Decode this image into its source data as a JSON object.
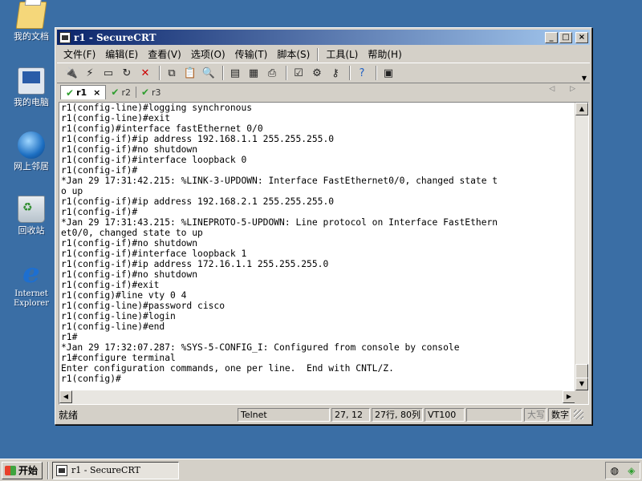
{
  "desktop": {
    "icons": [
      {
        "label": "我的文档"
      },
      {
        "label": "我的电脑"
      },
      {
        "label": "网上邻居"
      },
      {
        "label": "回收站"
      },
      {
        "label": "Internet Explorer"
      }
    ]
  },
  "window": {
    "title": "r1 - SecureCRT",
    "controls": {
      "minimize": "_",
      "maximize": "□",
      "close": "×"
    }
  },
  "menu": {
    "items": [
      "文件(F)",
      "编辑(E)",
      "查看(V)",
      "选项(O)",
      "传输(T)",
      "脚本(S)",
      "工具(L)",
      "帮助(H)"
    ]
  },
  "tabs": [
    {
      "label": "r1",
      "active": true,
      "close": "×"
    },
    {
      "label": "r2",
      "active": false
    },
    {
      "label": "r3",
      "active": false
    }
  ],
  "tab_nav": "◁ ▷",
  "terminal": {
    "lines": [
      "r1(config-line)#logging synchronous",
      "r1(config-line)#exit",
      "r1(config)#interface fastEthernet 0/0",
      "r1(config-if)#ip address 192.168.1.1 255.255.255.0",
      "r1(config-if)#no shutdown",
      "r1(config-if)#interface loopback 0",
      "r1(config-if)#",
      "*Jan 29 17:31:42.215: %LINK-3-UPDOWN: Interface FastEthernet0/0, changed state t",
      "o up",
      "r1(config-if)#ip address 192.168.2.1 255.255.255.0",
      "r1(config-if)#",
      "*Jan 29 17:31:43.215: %LINEPROTO-5-UPDOWN: Line protocol on Interface FastEthern",
      "et0/0, changed state to up",
      "r1(config-if)#no shutdown",
      "r1(config-if)#interface loopback 1",
      "r1(config-if)#ip address 172.16.1.1 255.255.255.0",
      "r1(config-if)#no shutdown",
      "r1(config-if)#exit",
      "r1(config)#line vty 0 4",
      "r1(config-line)#password cisco",
      "r1(config-line)#login",
      "r1(config-line)#end",
      "r1#",
      "*Jan 29 17:32:07.287: %SYS-5-CONFIG_I: Configured from console by console",
      "r1#configure terminal",
      "Enter configuration commands, one per line.  End with CNTL/Z.",
      "r1(config)#"
    ]
  },
  "statusbar": {
    "ready": "就绪",
    "protocol": "Telnet",
    "cursor": "27, 12",
    "size": "27行, 80列",
    "emulation": "VT100",
    "blank": "",
    "caps": "大写",
    "num": "数字"
  },
  "taskbar": {
    "start": "开始",
    "task": "r1 - SecureCRT"
  },
  "icons": {
    "toolbar": [
      "connect-icon",
      "quick-connect-icon",
      "connect-in-tab-icon",
      "reconnect-icon",
      "disconnect-icon",
      "copy-icon",
      "paste-icon",
      "find-icon",
      "print-setup-icon",
      "print-selection-icon",
      "print-icon",
      "session-options-icon",
      "global-options-icon",
      "keymap-icon",
      "help-icon",
      "snapshot-icon"
    ]
  }
}
